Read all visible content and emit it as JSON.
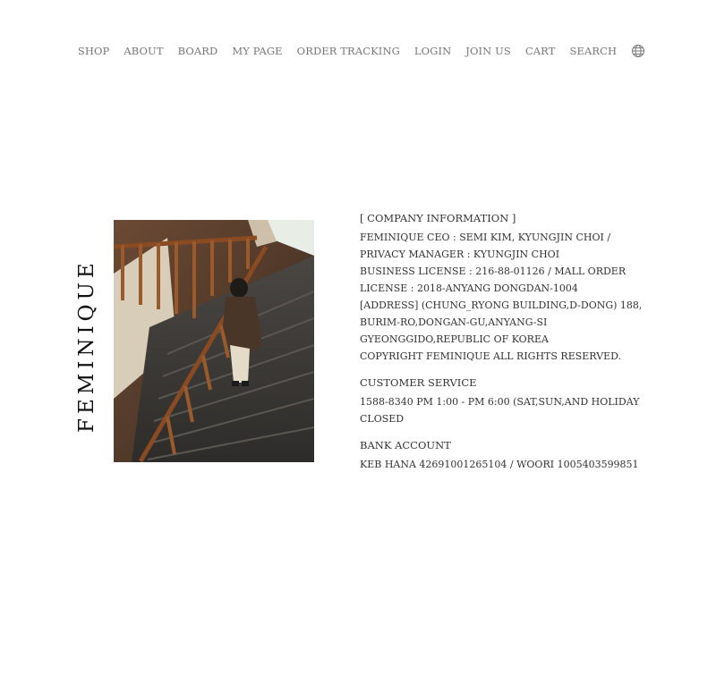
{
  "nav": {
    "items": [
      {
        "label": "SHOP"
      },
      {
        "label": "ABOUT"
      },
      {
        "label": "BOARD"
      },
      {
        "label": "MY PAGE"
      },
      {
        "label": "ORDER TRACKING"
      },
      {
        "label": "LOGIN"
      },
      {
        "label": "JOIN US"
      },
      {
        "label": "CART"
      },
      {
        "label": "SEARCH"
      }
    ],
    "language_icon": "globe-icon"
  },
  "brand": {
    "logo_text": "FEMINIQUE"
  },
  "company": {
    "heading": "[ COMPANY INFORMATION ]",
    "lines": [
      "FEMINIQUE CEO : SEMI KIM, KYUNGJIN CHOI / PRIVACY MANAGER : KYUNGJIN CHOI",
      "BUSINESS LICENSE : 216-88-01126 / MALL ORDER LICENSE : 2018-ANYANG DONGDAN-1004",
      "[ADDRESS] (CHUNG_RYONG BUILDING,D-DONG) 188, BURIM-RO,DONGAN-GU,ANYANG-SI GYEONGGIDO,REPUBLIC OF KOREA",
      "COPYRIGHT FEMINIQUE ALL RIGHTS RESERVED."
    ]
  },
  "customer_service": {
    "heading": "CUSTOMER SERVICE",
    "text": "1588-8340 PM 1:00 - PM 6:00 (SAT,SUN,AND HOLIDAY CLOSED"
  },
  "bank": {
    "heading": "BANK ACCOUNT",
    "text": "KEB HANA 42691001265104 / WOORI 1005403599851"
  },
  "colors": {
    "nav_text": "#777777",
    "body_text": "#333333",
    "logo": "#111111",
    "background": "#ffffff"
  }
}
